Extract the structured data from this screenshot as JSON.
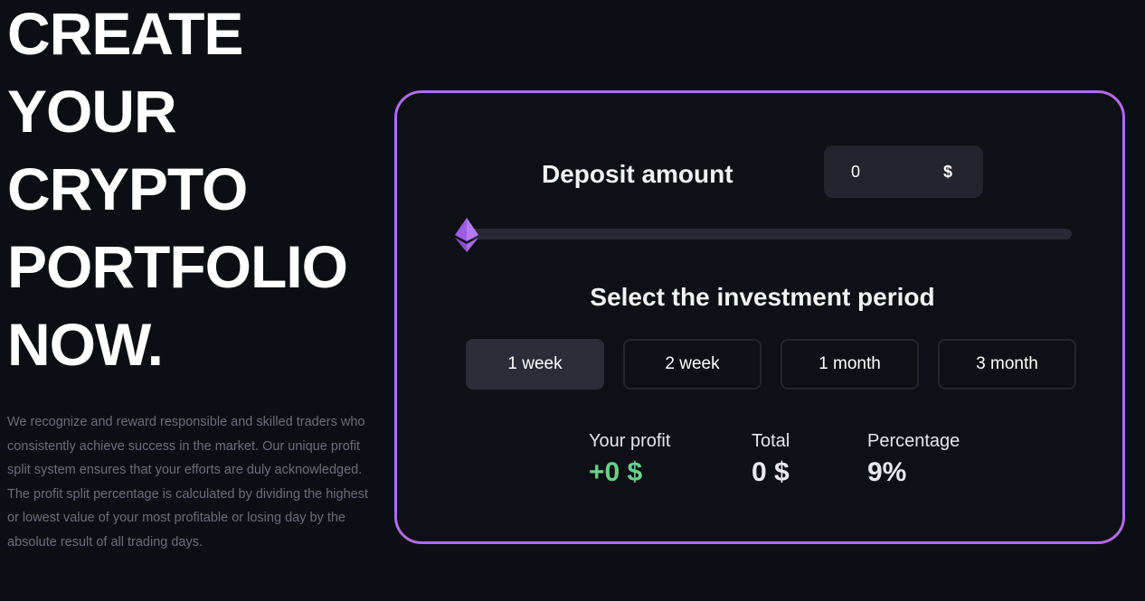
{
  "hero": {
    "headline": [
      "CREATE",
      "YOUR",
      "CRYPTO",
      "PORTFOLIO",
      "NOW."
    ],
    "description": "We recognize and reward responsible and skilled traders who consistently achieve success in the market. Our unique profit split system ensures that your efforts are duly acknowledged. The profit split percentage is calculated by dividing the highest or lowest value of your most profitable or losing day by the absolute result of all trading days."
  },
  "calculator": {
    "deposit_label": "Deposit amount",
    "deposit_value": "0",
    "deposit_currency": "$",
    "slider_value": 0,
    "slider_icon": "ethereum-icon",
    "period_title": "Select the investment period",
    "periods": [
      {
        "label": "1 week",
        "active": true
      },
      {
        "label": "2 week",
        "active": false
      },
      {
        "label": "1 month",
        "active": false
      },
      {
        "label": "3 month",
        "active": false
      }
    ],
    "stats": {
      "profit_label": "Your profit",
      "profit_value": "+0 $",
      "total_label": "Total",
      "total_value": "0 $",
      "percentage_label": "Percentage",
      "percentage_value": "9%"
    }
  },
  "colors": {
    "background": "#0d0e14",
    "card_border": "#b06de6",
    "profit_green": "#6ad08a",
    "active_button": "#2a2c37"
  }
}
